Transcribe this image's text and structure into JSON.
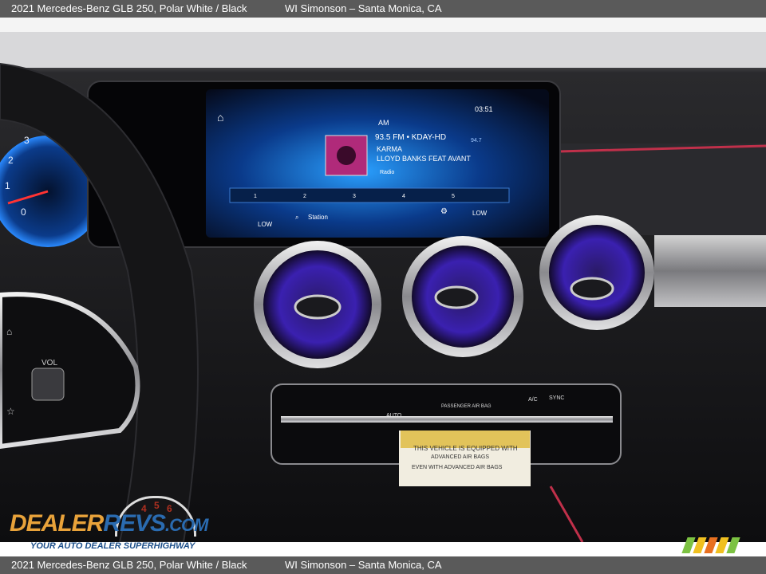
{
  "header": {
    "car": "2021 Mercedes-Benz GLB 250,  Polar White / Black",
    "dealer": "WI Simonson – Santa Monica, CA"
  },
  "footer": {
    "car": "2021 Mercedes-Benz GLB 250,  Polar White / Black",
    "dealer": "WI Simonson – Santa Monica, CA"
  },
  "screen": {
    "time": "03:51",
    "band": "AM",
    "station": "93.5 FM • KDAY-HD",
    "song": "KARMA",
    "artist": "LLOYD  BANKS FEAT AVANT",
    "freq_side": "94.7",
    "radio_logo": "Radio",
    "presets": [
      "1",
      "2",
      "3",
      "4",
      "5"
    ],
    "station_btn": "Station",
    "climate_left": "LOW",
    "climate_right": "LOW"
  },
  "gauge": {
    "ticks": [
      "3",
      "2",
      "1",
      "0"
    ]
  },
  "climate_panel": {
    "auto": "AUTO",
    "passenger_airbag": "PASSENGER AIR BAG",
    "ac": "A/C",
    "sync": "SYNC"
  },
  "sticker": {
    "line1": "THIS VEHICLE IS EQUIPPED WITH",
    "line2": "ADVANCED AIR BAGS",
    "line3": "EVEN WITH ADVANCED AIR BAGS"
  },
  "wheel": {
    "vol": "VOL"
  },
  "watermark": {
    "dealer": "DEALER",
    "revs": "REVS",
    "com": ".COM",
    "tagline": "YOUR AUTO DEALER SUPERHIGHWAY",
    "gauge_nums": [
      "4",
      "5",
      "6"
    ]
  },
  "colors": {
    "ambient": "#6a3cff",
    "screen_blue": "#1e88ff",
    "red_trim": "#c0304a",
    "watermark_orange": "#e8a23a",
    "watermark_blue": "#2a6bb0"
  }
}
